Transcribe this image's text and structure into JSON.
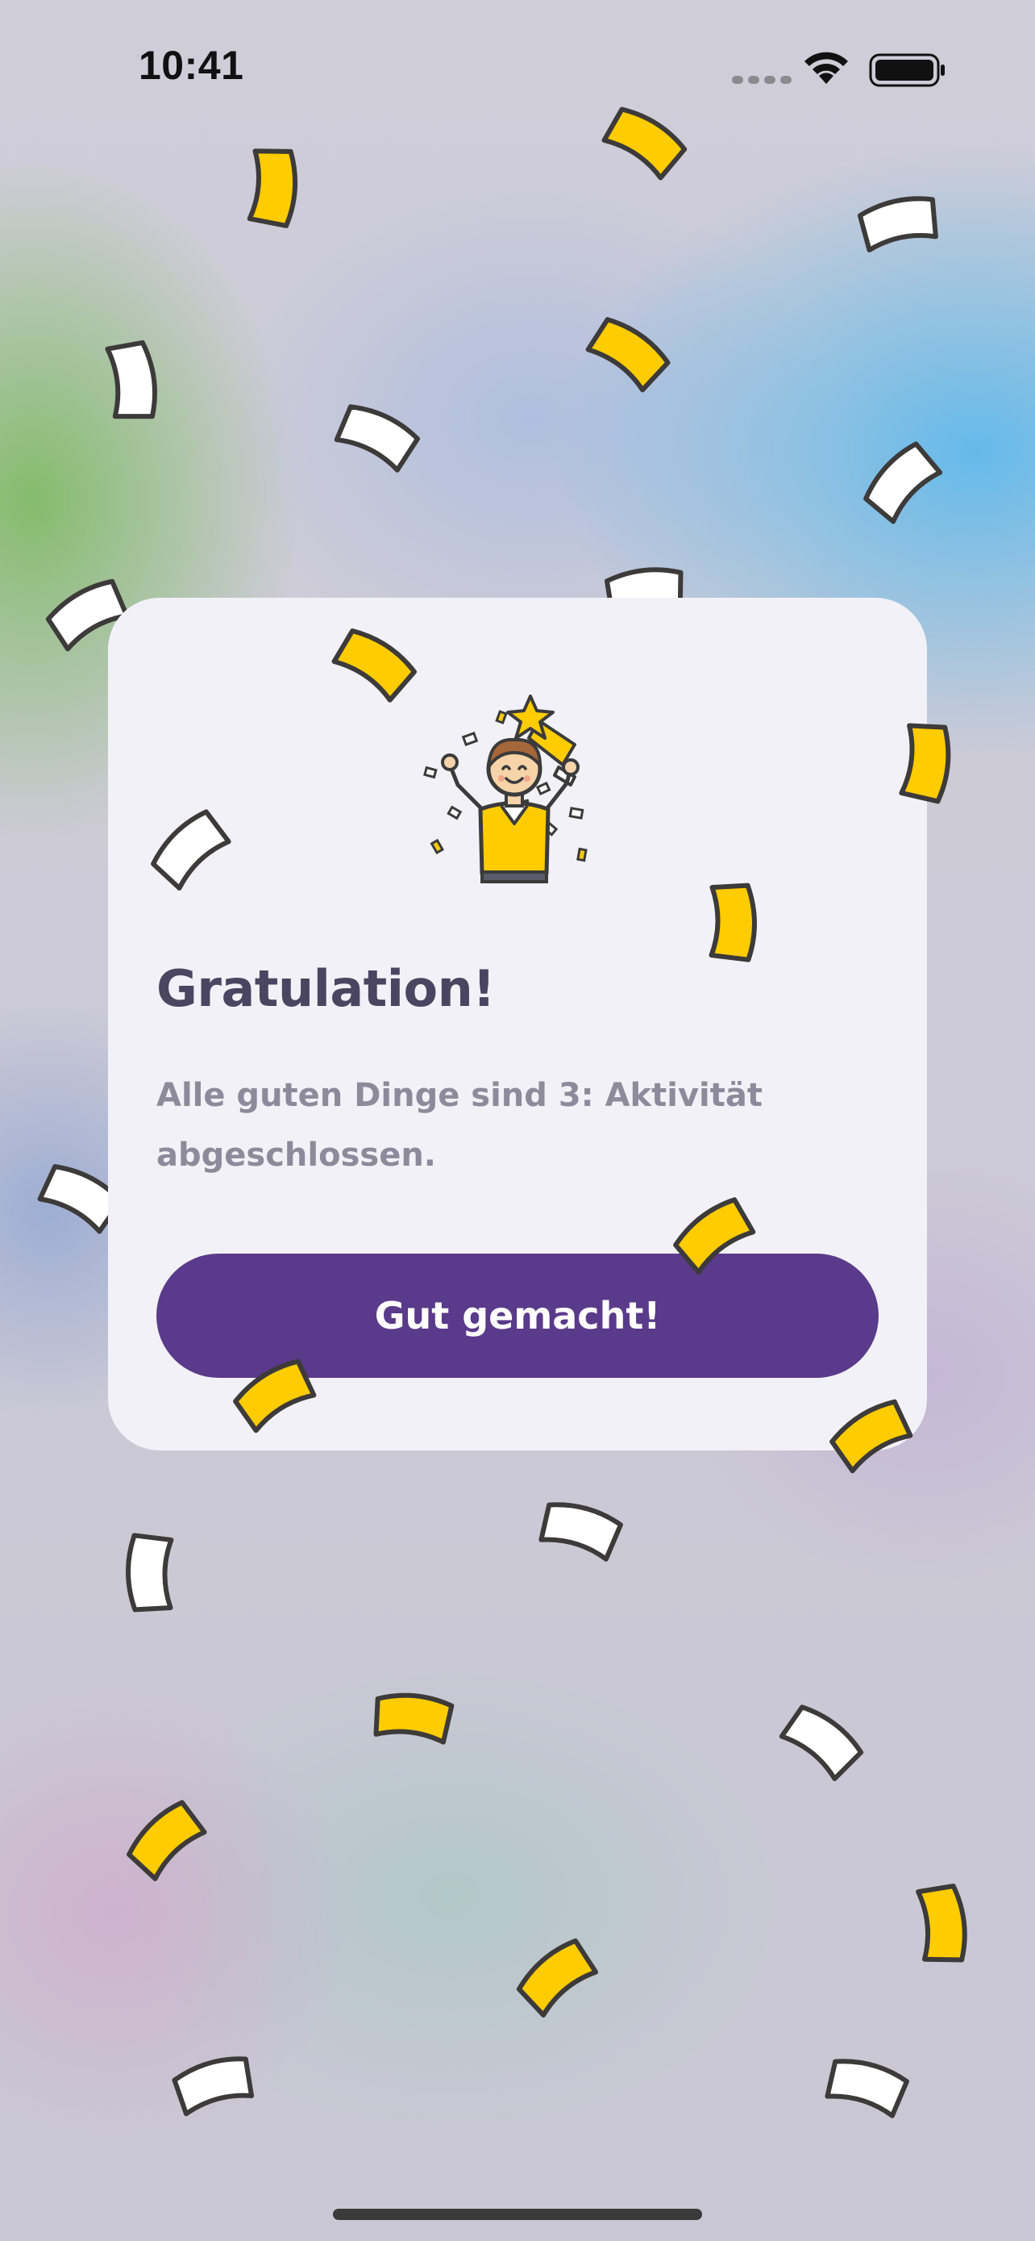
{
  "status_bar": {
    "time": "10:41"
  },
  "dialog": {
    "title": "Gratulation!",
    "message": "Alle guten Dinge sind 3: Aktivität abgeschlossen.",
    "button_label": "Gut gemacht!",
    "illustration_icon": "celebrating-person-with-trophy-icon"
  },
  "colors": {
    "accent": "#5a3a8a",
    "confetti_yellow": "#ffcc00",
    "confetti_white": "#ffffff",
    "card_background": "#f2f1f7",
    "title_text": "#4a4560",
    "message_text": "#8d8a9b"
  }
}
